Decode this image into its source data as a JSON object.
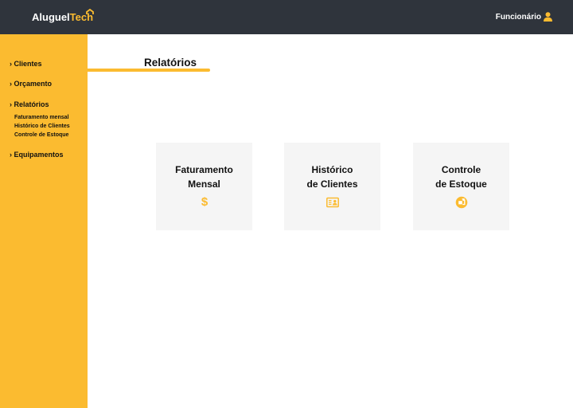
{
  "header": {
    "logo_main": "Aluguel",
    "logo_accent": "Tech",
    "user_label": "Funcionário"
  },
  "sidebar": {
    "items": [
      {
        "label": "› Clientes"
      },
      {
        "label": "› Orçamento"
      },
      {
        "label": "› Relatórios",
        "children": [
          {
            "label": "Faturamento mensal"
          },
          {
            "label": "Histórico de Clientes"
          },
          {
            "label": "Controle de Estoque"
          }
        ]
      },
      {
        "label": "› Equipamentos"
      }
    ]
  },
  "main": {
    "title": "Relatórios",
    "cards": [
      {
        "line1": "Faturamento",
        "line2": "Mensal",
        "icon": "dollar-icon",
        "glyph": "$"
      },
      {
        "line1": "Histórico",
        "line2": "de Clientes",
        "icon": "contact-card-icon"
      },
      {
        "line1": "Controle",
        "line2": "de Estoque",
        "icon": "stock-control-icon"
      }
    ]
  },
  "colors": {
    "accent": "#fbbb30",
    "topbar": "#2f343c",
    "card_bg": "#f5f5f5"
  }
}
